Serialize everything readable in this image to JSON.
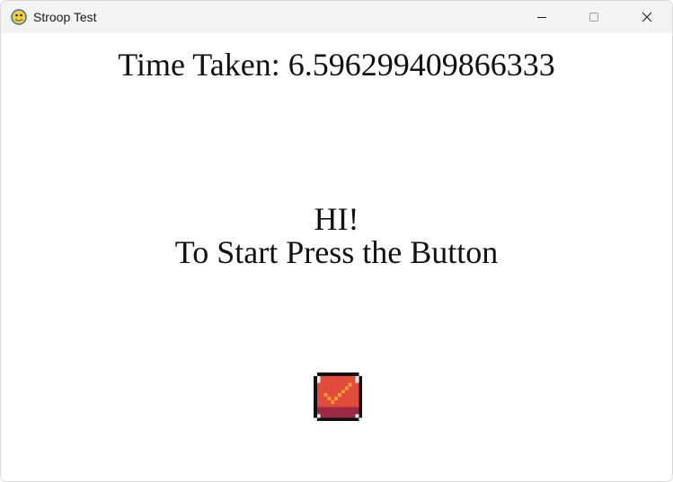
{
  "window": {
    "title": "Stroop Test",
    "icon": "pygame-snake-icon",
    "controls": [
      "minimize-icon",
      "maximize-icon",
      "close-icon"
    ]
  },
  "game": {
    "time_taken": "Time Taken: 6.596299409866333",
    "greeting_line1": "HI!",
    "greeting_line2": "To Start Press the Button",
    "start_button_icon": "checkmark-icon",
    "colors": {
      "button_fill": "#e24a3b",
      "button_shadow": "#9c2a45",
      "checkmark": "#f7a22f"
    }
  }
}
